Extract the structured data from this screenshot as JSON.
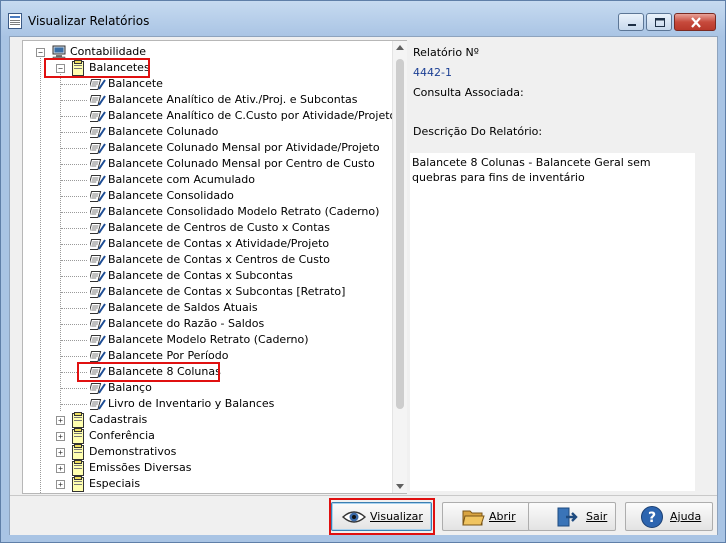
{
  "window": {
    "title": "Visualizar Relatórios"
  },
  "tree": {
    "root_label": "Contabilidade",
    "group_label": "Balancetes",
    "items": [
      "Balancete",
      "Balancete Analítico de Ativ./Proj. e Subcontas",
      "Balancete Analítico de C.Custo por Atividade/Projeto",
      "Balancete Colunado",
      "Balancete Colunado Mensal por Atividade/Projeto",
      "Balancete Colunado Mensal por Centro de Custo",
      "Balancete com Acumulado",
      "Balancete Consolidado",
      "Balancete Consolidado Modelo Retrato (Caderno)",
      "Balancete de Centros de Custo x Contas",
      "Balancete de Contas x Atividade/Projeto",
      "Balancete de Contas x Centros de Custo",
      "Balancete de Contas x Subcontas",
      "Balancete de Contas x Subcontas [Retrato]",
      "Balancete de Saldos Atuais",
      "Balancete do Razão - Saldos",
      "Balancete Modelo Retrato (Caderno)",
      "Balancete Por Período",
      "Balancete 8 Colunas",
      "Balanço",
      "Livro de Inventario y Balances"
    ],
    "selected_index": 18,
    "other_groups": [
      "Cadastrais",
      "Conferência",
      "Demonstrativos",
      "Emissões Diversas",
      "Especiais"
    ]
  },
  "detail": {
    "report_no_label": "Relatório Nº",
    "report_no_value": "4442-1",
    "query_label": "Consulta Associada:",
    "description_label": "Descrição Do Relatório:",
    "description_text": "Balancete 8 Colunas - Balancete Geral sem quebras para fins de inventário"
  },
  "buttons": {
    "visualizar": "Visualizar",
    "abrir": "Abrir",
    "sair": "Sair",
    "ajuda": "Ajuda"
  },
  "colors": {
    "highlight": "#e01010",
    "title_bar": "#a9c4e4",
    "value_text": "#1c3f94"
  },
  "icons": {
    "app": "report-window-icon",
    "root": "computer-icon",
    "group": "clipboard-folder-icon",
    "report": "report-pencil-icon",
    "visualizar": "eye-icon",
    "abrir": "open-folder-icon",
    "sair": "exit-door-icon",
    "ajuda": "help-icon"
  }
}
